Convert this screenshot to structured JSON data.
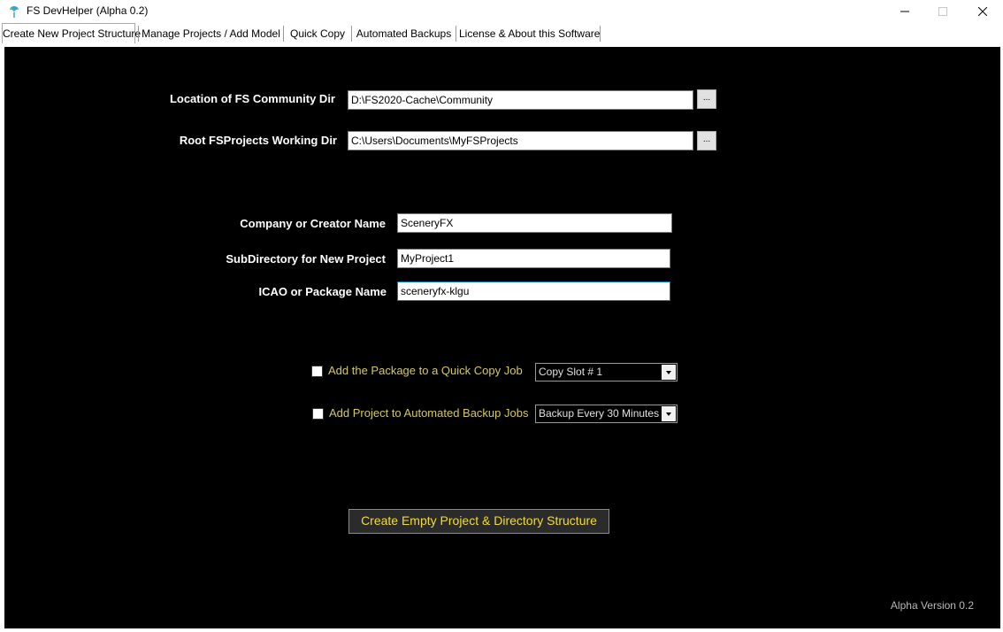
{
  "window": {
    "title": "FS DevHelper (Alpha 0.2)",
    "controls": {
      "minimize": "—",
      "maximize": "☐",
      "close": "✕"
    }
  },
  "tabs": [
    {
      "label": "Create New Project Structure",
      "active": true
    },
    {
      "label": "Manage Projects / Add Model",
      "active": false
    },
    {
      "label": "Quick Copy",
      "active": false
    },
    {
      "label": "Automated Backups",
      "active": false
    },
    {
      "label": "License & About this Software",
      "active": false
    }
  ],
  "paths": {
    "community": {
      "label": "Location of FS Community Dir",
      "value": "D:\\FS2020-Cache\\Community",
      "browse": "..."
    },
    "projects": {
      "label": "Root FSProjects Working Dir",
      "value": "C:\\Users\\Documents\\MyFSProjects",
      "browse": "..."
    }
  },
  "project": {
    "company": {
      "label": "Company or Creator Name",
      "value": "SceneryFX"
    },
    "subdir": {
      "label": "SubDirectory for New Project",
      "value": "MyProject1"
    },
    "icao": {
      "label": "ICAO or Package Name",
      "value": "sceneryfx-klgu"
    }
  },
  "options": {
    "quick_copy": {
      "label": "Add the Package to a Quick Copy Job",
      "checked": false,
      "select": "Copy Slot # 1"
    },
    "backup": {
      "label": "Add Project to Automated Backup Jobs",
      "checked": false,
      "select": "Backup Every 30 Minutes"
    }
  },
  "create_button": "Create Empty Project & Directory Structure",
  "version": "Alpha Version 0.2",
  "colors": {
    "panel": "#000000",
    "accent_text": "#d4c95e",
    "button_text": "#f0dc32"
  }
}
